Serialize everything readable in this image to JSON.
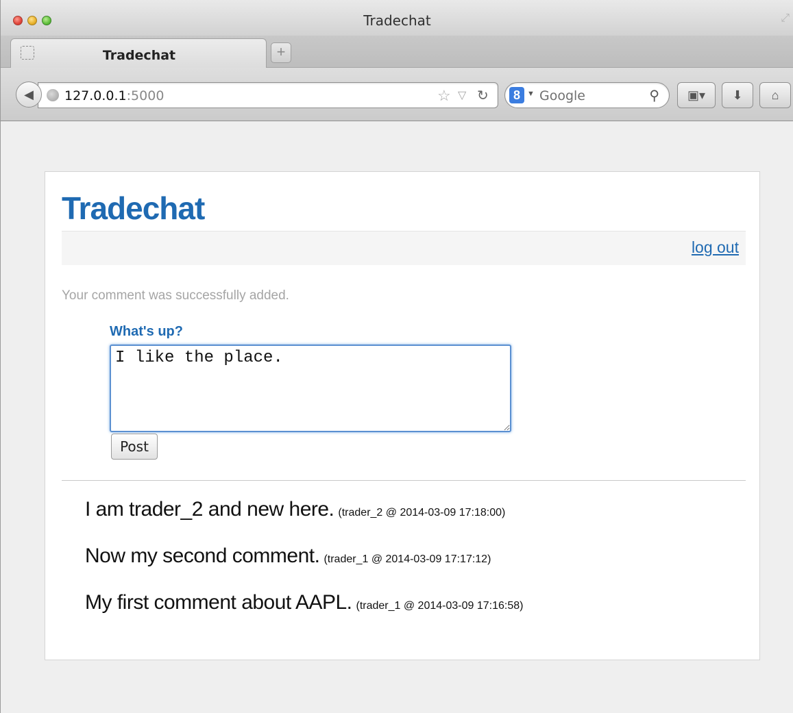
{
  "window": {
    "title": "Tradechat"
  },
  "tabs": [
    {
      "label": "Tradechat"
    }
  ],
  "toolbar": {
    "url_host": "127.0.0.1",
    "url_port": ":5000",
    "search_engine": "8",
    "search_placeholder": "Google"
  },
  "page": {
    "site_title": "Tradechat",
    "nav": {
      "logout_label": "log out"
    },
    "flash_message": "Your comment was successfully added.",
    "form": {
      "label": "What's up?",
      "comment_value": "I like the place.",
      "post_label": "Post"
    },
    "comments": [
      {
        "text": "I am trader_2 and new here.",
        "meta": "(trader_2 @ 2014-03-09 17:18:00)"
      },
      {
        "text": "Now my second comment.",
        "meta": "(trader_1 @ 2014-03-09 17:17:12)"
      },
      {
        "text": "My first comment about AAPL.",
        "meta": "(trader_1 @ 2014-03-09 17:16:58)"
      }
    ]
  },
  "colors": {
    "brand": "#1f6ab2",
    "flash": "#a5a5a5"
  },
  "icons": [
    "close-icon",
    "minimize-icon",
    "zoom-icon",
    "resize-icon",
    "favicon-placeholder-icon",
    "new-tab-icon",
    "back-icon",
    "globe-icon",
    "star-icon",
    "reader-icon",
    "reload-icon",
    "google-icon",
    "search-icon",
    "bookmarks-icon",
    "download-icon",
    "home-icon"
  ]
}
